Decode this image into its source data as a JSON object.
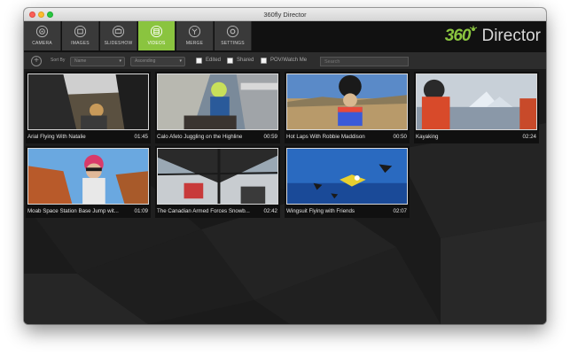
{
  "window": {
    "title": "360fly Director"
  },
  "nav": {
    "tabs": [
      {
        "label": "CAMERA",
        "icon": "camera-icon",
        "active": false
      },
      {
        "label": "IMAGES",
        "icon": "image-icon",
        "active": false
      },
      {
        "label": "SLIDESHOW",
        "icon": "slideshow-icon",
        "active": false
      },
      {
        "label": "VIDEOS",
        "icon": "video-icon",
        "active": true
      },
      {
        "label": "MERGE",
        "icon": "merge-icon",
        "active": false
      },
      {
        "label": "SETTINGS",
        "icon": "settings-icon",
        "active": false
      }
    ],
    "logo_number": "360",
    "logo_word": "Director",
    "accent": "#8ac43f"
  },
  "toolbar": {
    "add_icon": "+",
    "sort_label": "Sort By",
    "sort_value": "Name",
    "order_value": "Ascending",
    "filters": [
      {
        "label": "Edited",
        "checked": false
      },
      {
        "label": "Shared",
        "checked": false
      },
      {
        "label": "POV/Watch Me",
        "checked": false
      }
    ],
    "search_placeholder": "Search"
  },
  "videos": [
    {
      "title": "Arial Flying With Natalie",
      "duration": "01:45"
    },
    {
      "title": "Calo Afeto Juggling on the Highline",
      "duration": "00:59"
    },
    {
      "title": "Hot Laps With Robbie Maddison",
      "duration": "00:50"
    },
    {
      "title": "Kayaking",
      "duration": "02:24"
    },
    {
      "title": "Moab Space Station Base Jump wit...",
      "duration": "01:09"
    },
    {
      "title": "The Canadian Armed Forces Snowb...",
      "duration": "02:42"
    },
    {
      "title": "Wingsuit Flying with Friends",
      "duration": "02:07"
    }
  ]
}
